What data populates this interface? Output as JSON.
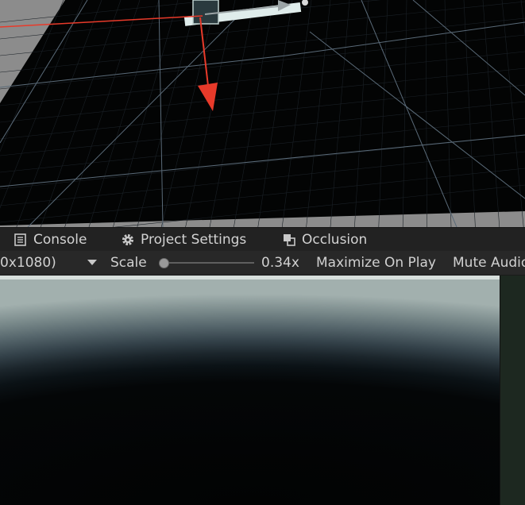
{
  "scene": {
    "background_color": "#8c8c8c",
    "plane_color": "#000000",
    "grid_color": "#5a6a78",
    "axis_x_color": "#e83a2a",
    "axis_z_color": "#7f8a90"
  },
  "tabs": [
    {
      "label": "Console",
      "icon": "console-list-icon"
    },
    {
      "label": "Project Settings",
      "icon": "gear-icon"
    },
    {
      "label": "Occlusion",
      "icon": "occlusion-icon"
    }
  ],
  "toolbar": {
    "resolution_label": "0x1080)",
    "resolution_dropdown_icon": "dropdown-arrow-icon",
    "scale_label": "Scale",
    "scale_value_text": "0.34x",
    "scale_level": 0.34,
    "maximize_label": "Maximize On Play",
    "mute_label": "Mute Audio"
  },
  "game_view": {
    "sky_top_color": "#a2b0ae",
    "ground_color": "#020303"
  }
}
